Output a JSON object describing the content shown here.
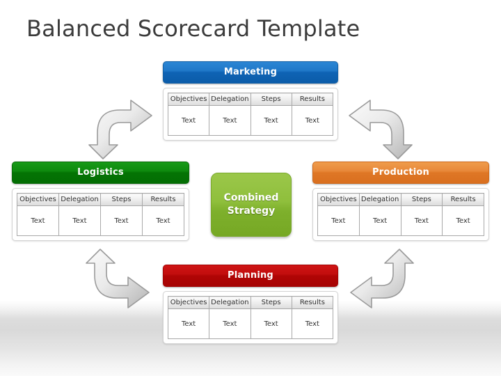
{
  "slide": {
    "title": "Balanced Scorecard Template"
  },
  "center": {
    "label_line1": "Combined",
    "label_line2": "Strategy",
    "color": "#8fbf3c",
    "icon": "rounded-tile"
  },
  "columns": [
    "Objectives",
    "Delegation",
    "Steps",
    "Results"
  ],
  "panels": [
    {
      "id": "marketing",
      "title": "Marketing",
      "color": "#1f78c8",
      "position": "top",
      "columns": [
        "Objectives",
        "Delegation",
        "Steps",
        "Results"
      ],
      "cells": [
        "Text",
        "Text",
        "Text",
        "Text"
      ]
    },
    {
      "id": "logistics",
      "title": "Logistics",
      "color": "#0e8a0e",
      "position": "left",
      "columns": [
        "Objectives",
        "Delegation",
        "Steps",
        "Results"
      ],
      "cells": [
        "Text",
        "Text",
        "Text",
        "Text"
      ]
    },
    {
      "id": "production",
      "title": "Production",
      "color": "#e8883a",
      "position": "right",
      "columns": [
        "Objectives",
        "Delegation",
        "Steps",
        "Results"
      ],
      "cells": [
        "Text",
        "Text",
        "Text",
        "Text"
      ]
    },
    {
      "id": "planning",
      "title": "Planning",
      "color": "#c20d0d",
      "position": "bottom",
      "columns": [
        "Objectives",
        "Delegation",
        "Steps",
        "Results"
      ],
      "cells": [
        "Text",
        "Text",
        "Text",
        "Text"
      ]
    }
  ],
  "arrows": [
    {
      "id": "arrow-top-left",
      "icon": "bent-arrow-icon",
      "color": "#b0b0b0"
    },
    {
      "id": "arrow-top-right",
      "icon": "bent-arrow-icon",
      "color": "#b0b0b0"
    },
    {
      "id": "arrow-bottom-left",
      "icon": "bent-arrow-icon",
      "color": "#b0b0b0"
    },
    {
      "id": "arrow-bottom-right",
      "icon": "bent-arrow-icon",
      "color": "#b0b0b0"
    }
  ]
}
